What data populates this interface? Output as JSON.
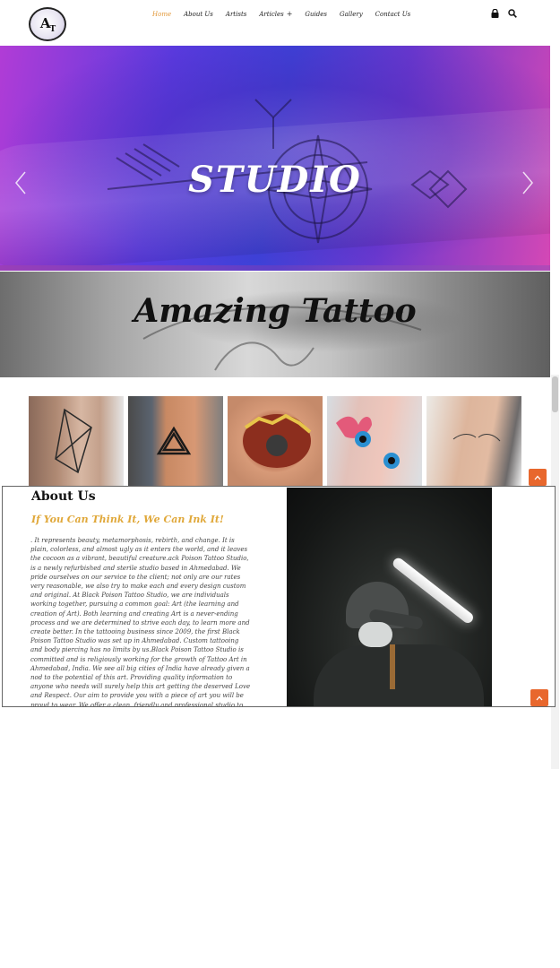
{
  "header": {
    "logo_text": "A",
    "logo_sub": "T",
    "nav": [
      {
        "label": "Home",
        "active": true
      },
      {
        "label": "About Us"
      },
      {
        "label": "Artists"
      },
      {
        "label": "Articles",
        "suffix": "+"
      },
      {
        "label": "Guides"
      },
      {
        "label": "Gallery"
      },
      {
        "label": "Contact Us"
      }
    ],
    "icons": [
      "lock-icon",
      "search-icon"
    ]
  },
  "hero": {
    "title": "STUDIO",
    "controls": [
      "chevron-left-icon",
      "chevron-right-icon"
    ]
  },
  "banner": {
    "title": "Amazing Tattoo"
  },
  "gallery": {
    "items": [
      "tattoo-photo-1",
      "tattoo-photo-2",
      "tattoo-photo-3",
      "tattoo-photo-4",
      "tattoo-photo-5"
    ]
  },
  "about": {
    "heading": "About Us",
    "tagline": "If You Can Think It, We Can Ink It!",
    "body": ". It represents beauty, metamorphosis, rebirth, and change. It is plain, colorless, and almost ugly as it enters the world, and it leaves the cocoon as a vibrant, beautiful creature.ack Poison Tattoo Studio, is a newly refurbished and sterile studio based in Ahmedabad. We pride ourselves on our service to the client; not only are our rates very reasonable, we also try to make each and every design custom and original. At Black Poison Tattoo Studio, we are individuals working together, pursuing a common goal: Art (the learning and creation of Art). Both learning and creating Art is a never-ending process and we are determined to strive each day, to learn more and create better. In the tattooing business since 2009, the first Black Poison Tattoo Studio was set up in Ahmedabad. Custom tattooing and body piercing has no limits by us.Black Poison Tattoo Studio is committed and is religiously working for the growth of Tattoo Art in Ahmedabad, India. We see all big cities of India have already given a nod to the potential of this art. Providing quality information to anyone who needs will surely help this art getting the deserved Love and Respect. Our aim to provide you with a piece of art you will be proud to wear. We offer a clean, friendly and professional studio to ensure that your tattoo experience is as enjoyable as possible. 100% privacy and comfort is guaranteed during your appointment.Black Poison"
  },
  "colors": {
    "accent": "#e39a3d",
    "tagline": "#e0a83a",
    "to_top_button": "#e8672d"
  }
}
